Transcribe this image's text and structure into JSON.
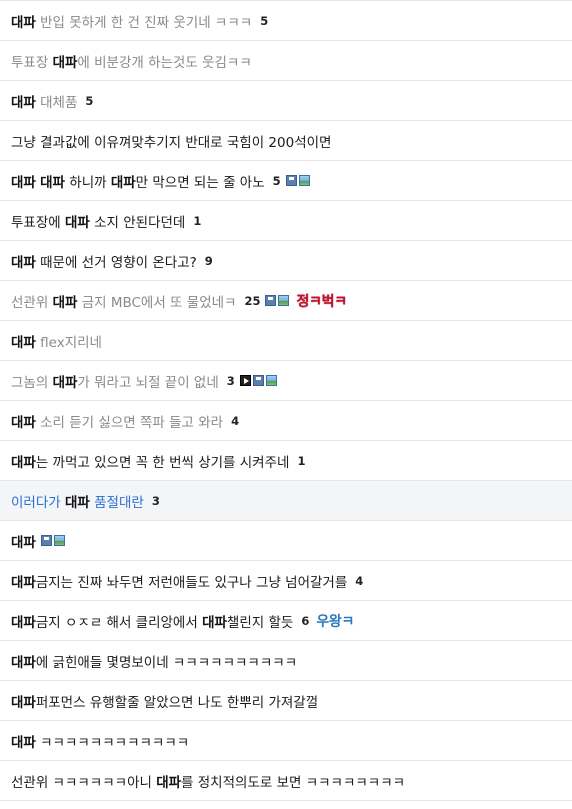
{
  "rows": [
    {
      "state": "visited",
      "segments": [
        {
          "t": "대파",
          "kw": true
        },
        {
          "t": " 반입 못하게 한 건 진짜 웃기네 ㅋㅋㅋ",
          "kw": false
        }
      ],
      "count": "5",
      "icons": [],
      "nick": null
    },
    {
      "state": "visited",
      "segments": [
        {
          "t": "투표장 ",
          "kw": false
        },
        {
          "t": "대파",
          "kw": true
        },
        {
          "t": "에 비분강개 하는것도 웃김ㅋㅋ",
          "kw": false
        }
      ],
      "count": "",
      "icons": [],
      "nick": null
    },
    {
      "state": "visited",
      "segments": [
        {
          "t": "대파",
          "kw": true
        },
        {
          "t": " 대체품",
          "kw": false
        }
      ],
      "count": "5",
      "icons": [],
      "nick": null
    },
    {
      "state": "unread",
      "segments": [
        {
          "t": "그냥 결과값에 이유껴맞추기지 반대로 국힘이 200석이면",
          "kw": false
        }
      ],
      "count": "",
      "icons": [],
      "nick": null
    },
    {
      "state": "unread",
      "segments": [
        {
          "t": "대파",
          "kw": true
        },
        {
          "t": " ",
          "kw": false
        },
        {
          "t": "대파",
          "kw": true
        },
        {
          "t": " 하니까 ",
          "kw": false
        },
        {
          "t": "대파",
          "kw": true
        },
        {
          "t": "만 막으면 되는 줄 아노",
          "kw": false
        }
      ],
      "count": "5",
      "icons": [
        {
          "name": "disk-icon",
          "cls": "disk"
        },
        {
          "name": "image-icon",
          "cls": "img"
        }
      ],
      "nick": null
    },
    {
      "state": "unread",
      "segments": [
        {
          "t": "투표장에 ",
          "kw": false
        },
        {
          "t": "대파",
          "kw": true
        },
        {
          "t": " 소지 안된다던데",
          "kw": false
        }
      ],
      "count": "1",
      "icons": [],
      "nick": null
    },
    {
      "state": "unread",
      "segments": [
        {
          "t": "대파",
          "kw": true
        },
        {
          "t": " 때문에 선거 영향이 온다고?",
          "kw": false
        }
      ],
      "count": "9",
      "icons": [],
      "nick": null
    },
    {
      "state": "visited",
      "segments": [
        {
          "t": "선관위 ",
          "kw": false
        },
        {
          "t": "대파",
          "kw": true
        },
        {
          "t": " 금지 MBC에서 또 물었네ㅋ",
          "kw": false
        }
      ],
      "count": "25",
      "icons": [
        {
          "name": "disk-icon",
          "cls": "disk"
        },
        {
          "name": "image-icon",
          "cls": "img"
        }
      ],
      "nick": {
        "text": "정ㅋ벅ㅋ",
        "color": "red"
      }
    },
    {
      "state": "visited",
      "segments": [
        {
          "t": "대파",
          "kw": true
        },
        {
          "t": " flex지리네",
          "kw": false
        }
      ],
      "count": "",
      "icons": [],
      "nick": null
    },
    {
      "state": "visited",
      "segments": [
        {
          "t": "그놈의 ",
          "kw": false
        },
        {
          "t": "대파",
          "kw": true
        },
        {
          "t": "가 뭐라고 뇌절 끝이 없네",
          "kw": false
        }
      ],
      "count": "3",
      "icons": [
        {
          "name": "video-icon",
          "cls": "vid"
        },
        {
          "name": "disk-icon",
          "cls": "disk"
        },
        {
          "name": "image-icon",
          "cls": "img"
        }
      ],
      "nick": null
    },
    {
      "state": "visited",
      "segments": [
        {
          "t": "대파",
          "kw": true
        },
        {
          "t": " 소리 듣기 싫으면 쪽파 들고 와라",
          "kw": false
        }
      ],
      "count": "4",
      "icons": [],
      "nick": null
    },
    {
      "state": "unread",
      "segments": [
        {
          "t": "대파",
          "kw": true
        },
        {
          "t": "는 까먹고 있으면 꼭 한 번씩 상기를 시켜주네",
          "kw": false
        }
      ],
      "count": "1",
      "icons": [],
      "nick": null
    },
    {
      "state": "hl",
      "segments": [
        {
          "t": "이러다가 ",
          "kw": false
        },
        {
          "t": "대파",
          "kw": true
        },
        {
          "t": " 품절대란",
          "kw": false
        }
      ],
      "count": "3",
      "icons": [],
      "nick": null
    },
    {
      "state": "unread",
      "segments": [
        {
          "t": "대파",
          "kw": true
        }
      ],
      "count": "",
      "icons": [
        {
          "name": "disk-icon",
          "cls": "disk"
        },
        {
          "name": "image-icon",
          "cls": "img"
        }
      ],
      "nick": null
    },
    {
      "state": "unread",
      "segments": [
        {
          "t": "대파",
          "kw": true
        },
        {
          "t": "금지는 진짜 놔두면 저런애들도 있구나 그냥 넘어갈거를",
          "kw": false
        }
      ],
      "count": "4",
      "icons": [],
      "nick": null
    },
    {
      "state": "unread",
      "segments": [
        {
          "t": "대파",
          "kw": true
        },
        {
          "t": "금지 ㅇㅈㄹ 해서 클리앙에서 ",
          "kw": false
        },
        {
          "t": "대파",
          "kw": true
        },
        {
          "t": "챌린지 할듯",
          "kw": false
        }
      ],
      "count": "6",
      "icons": [],
      "nick": {
        "text": "우왕ㅋ",
        "color": "blue"
      }
    },
    {
      "state": "unread",
      "segments": [
        {
          "t": "대파",
          "kw": true
        },
        {
          "t": "에 긁힌애들 몇명보이네 ㅋㅋㅋㅋㅋㅋㅋㅋㅋㅋ",
          "kw": false
        }
      ],
      "count": "",
      "icons": [],
      "nick": null
    },
    {
      "state": "unread",
      "segments": [
        {
          "t": "대파",
          "kw": true
        },
        {
          "t": "퍼포먼스 유행할줄 알았으면 나도 한뿌리 가져갈껄",
          "kw": false
        }
      ],
      "count": "",
      "icons": [],
      "nick": null
    },
    {
      "state": "unread",
      "segments": [
        {
          "t": "대파",
          "kw": true
        },
        {
          "t": " ㅋㅋㅋㅋㅋㅋㅋㅋㅋㅋㅋㅋ",
          "kw": false
        }
      ],
      "count": "",
      "icons": [],
      "nick": null
    },
    {
      "state": "unread",
      "segments": [
        {
          "t": "선관위 ㅋㅋㅋㅋㅋㅋ아니 ",
          "kw": false
        },
        {
          "t": "대파",
          "kw": true
        },
        {
          "t": "를 정치적의도로 보면 ㅋㅋㅋㅋㅋㅋㅋㅋ",
          "kw": false
        }
      ],
      "count": "",
      "icons": [],
      "nick": null
    }
  ]
}
